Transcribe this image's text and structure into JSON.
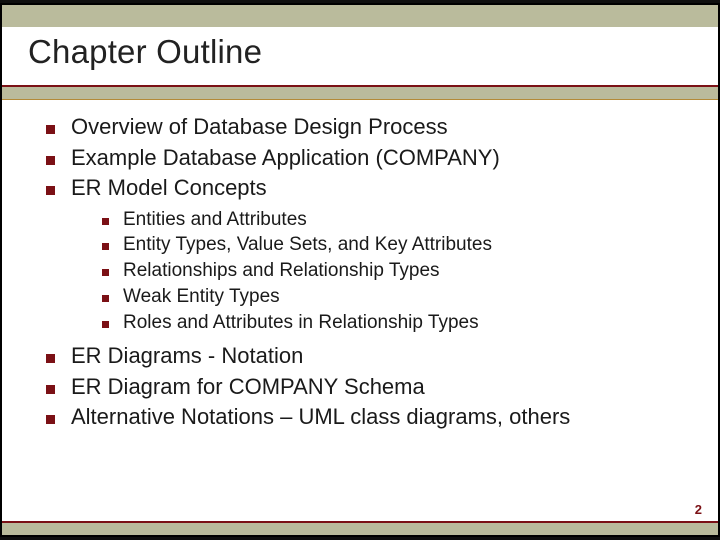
{
  "title": "Chapter Outline",
  "bullets": {
    "b0": "Overview of Database Design Process",
    "b1": "Example Database Application (COMPANY)",
    "b2": "ER Model Concepts",
    "b3": "ER Diagrams - Notation",
    "b4": "ER Diagram for COMPANY Schema",
    "b5": "Alternative Notations – UML class diagrams, others"
  },
  "subbullets": {
    "s0": "Entities and Attributes",
    "s1": "Entity Types, Value Sets, and Key Attributes",
    "s2": "Relationships and Relationship Types",
    "s3": "Weak Entity Types",
    "s4": "Roles and Attributes in Relationship Types"
  },
  "page_number": "2",
  "colors": {
    "accent_dark_red": "#7b1015",
    "beige": "#babb9c"
  }
}
